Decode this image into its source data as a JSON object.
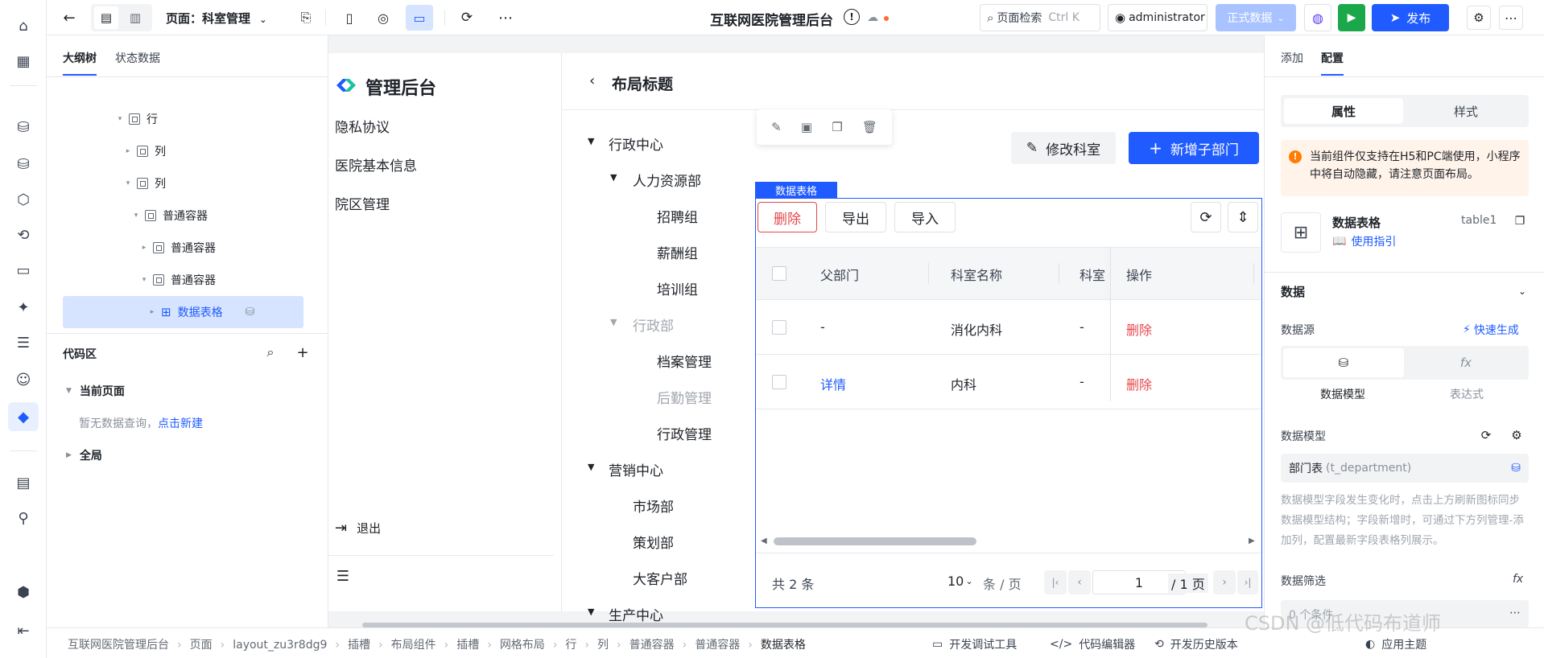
{
  "topbar": {
    "page_label": "页面：科室管理",
    "app_title": "互联网医院管理后台",
    "search_placeholder": "页面检索",
    "search_shortcut": "Ctrl K",
    "user": "administrator",
    "env_label": "正式数据",
    "publish_label": "发布"
  },
  "left_panel": {
    "tabs": [
      "大纲树",
      "状态数据"
    ],
    "tree": [
      {
        "label": "行",
        "depth": 0,
        "caret": "▾"
      },
      {
        "label": "列",
        "depth": 1,
        "caret": "▸"
      },
      {
        "label": "列",
        "depth": 1,
        "caret": "▾"
      },
      {
        "label": "普通容器",
        "depth": 2,
        "caret": "▾"
      },
      {
        "label": "普通容器",
        "depth": 3,
        "caret": "▸"
      },
      {
        "label": "普通容器",
        "depth": 3,
        "caret": "▾"
      },
      {
        "label": "数据表格",
        "depth": 4,
        "caret": "▸"
      }
    ],
    "code_area": {
      "title": "代码区",
      "current_page": "当前页面",
      "empty_text": "暂无数据查询，",
      "create_link": "点击新建",
      "global": "全局"
    }
  },
  "app_sidebar": {
    "brand": "管理后台",
    "menu": [
      "隐私协议",
      "医院基本信息",
      "院区管理"
    ],
    "logout": "退出"
  },
  "layout": {
    "title": "布局标题",
    "edit_button": "修改科室",
    "add_button": "新增子部门",
    "dept_tree": [
      {
        "label": "行政中心",
        "level": 0,
        "caret": "▼",
        "muted": false
      },
      {
        "label": "人力资源部",
        "level": 1,
        "caret": "▼",
        "muted": false
      },
      {
        "label": "招聘组",
        "level": 2,
        "caret": "",
        "muted": false
      },
      {
        "label": "薪酬组",
        "level": 2,
        "caret": "",
        "muted": false
      },
      {
        "label": "培训组",
        "level": 2,
        "caret": "",
        "muted": false
      },
      {
        "label": "行政部",
        "level": 1,
        "caret": "▼",
        "muted": true
      },
      {
        "label": "档案管理",
        "level": 2,
        "caret": "",
        "muted": false
      },
      {
        "label": "后勤管理",
        "level": 2,
        "caret": "",
        "muted": true
      },
      {
        "label": "行政管理",
        "level": 2,
        "caret": "",
        "muted": false
      },
      {
        "label": "营销中心",
        "level": 0,
        "caret": "▼",
        "muted": false
      },
      {
        "label": "市场部",
        "level": 1,
        "caret": "",
        "muted": false
      },
      {
        "label": "策划部",
        "level": 1,
        "caret": "",
        "muted": false
      },
      {
        "label": "大客户部",
        "level": 1,
        "caret": "",
        "muted": false
      },
      {
        "label": "生产中心",
        "level": 0,
        "caret": "▼",
        "muted": false
      }
    ]
  },
  "table": {
    "tag": "数据表格",
    "toolbar": [
      "删除",
      "导出",
      "导入"
    ],
    "columns": [
      "父部门",
      "科室名称",
      "科室",
      "操作"
    ],
    "rows": [
      {
        "parent": "-",
        "name": "消化内科",
        "code": "-",
        "action": "删除"
      },
      {
        "parent": "详情",
        "name": "内科",
        "code": "-",
        "action": "删除"
      }
    ],
    "total": "共 2 条",
    "page_size": "10",
    "per_page": "条 / 页",
    "page": "1",
    "pages": "/ 1 页"
  },
  "right_panel": {
    "tabs": [
      "添加",
      "配置"
    ],
    "seg": [
      "属性",
      "样式"
    ],
    "notice": "当前组件仅支持在H5和PC端使用，小程序中将自动隐藏，请注意页面布局。",
    "component_name": "数据表格",
    "component_id": "table1",
    "guide": "使用指引",
    "section_data": "数据",
    "datasource_label": "数据源",
    "quick_gen": "快速生成",
    "ds_options": [
      "数据模型",
      "表达式"
    ],
    "model_label": "数据模型",
    "model_value": "部门表",
    "model_table": "(t_department)",
    "model_hint": "数据模型字段发生变化时，点击上方刷新图标同步数据模型结构；字段新增时，可通过下方列管理-添加列，配置最新字段表格列展示。",
    "filter_label": "数据筛选",
    "filter_value": "0 个条件"
  },
  "bottom": {
    "breadcrumb": [
      "互联网医院管理后台",
      "页面",
      "layout_zu3r8dg9",
      "插槽",
      "布局组件",
      "插槽",
      "网格布局",
      "行",
      "列",
      "普通容器",
      "普通容器",
      "数据表格"
    ],
    "tools": [
      "开发调试工具",
      "代码编辑器",
      "开发历史版本",
      "应用主题"
    ],
    "watermark": "CSDN @低代码布道师"
  },
  "colors": {
    "primary": "#1f5bff",
    "danger": "#e5484d",
    "green": "#1ba84a",
    "selected": "#d6e4ff"
  }
}
